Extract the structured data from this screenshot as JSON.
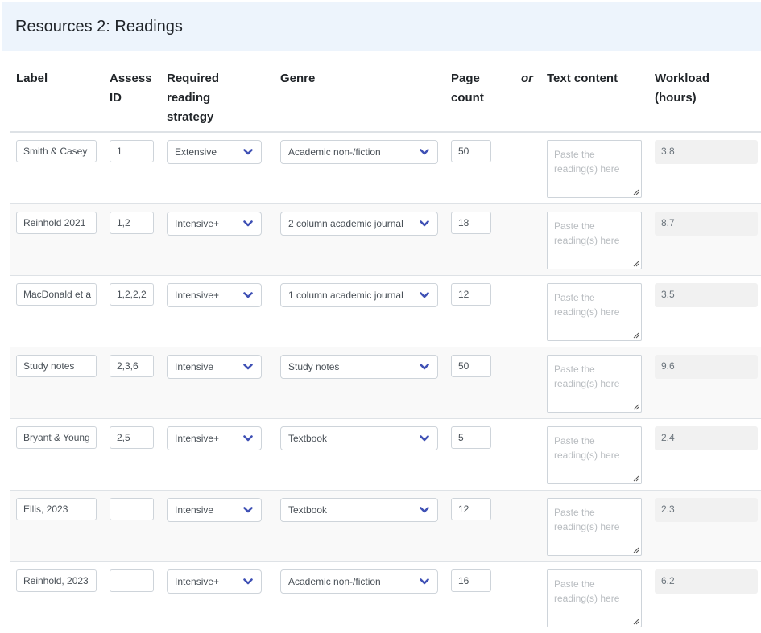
{
  "section": {
    "title": "Resources 2: Readings"
  },
  "columns": {
    "label": "Label",
    "assess_id": "Assess ID",
    "strategy": "Required reading strategy",
    "genre": "Genre",
    "page_count": "Page count",
    "or": "or",
    "text_content": "Text content",
    "workload": "Workload (hours)"
  },
  "textarea_placeholder": "Paste the reading(s) here",
  "colors": {
    "header_bg": "#edf4fc",
    "chevron": "#3f51b5",
    "row_alt_bg": "#f9f9f9"
  },
  "rows": [
    {
      "label": "Smith & Casey",
      "assess_id": "1",
      "strategy": "Extensive",
      "genre": "Academic non-/fiction",
      "page_count": "50",
      "workload": "3.8"
    },
    {
      "label": "Reinhold 2021",
      "assess_id": "1,2",
      "strategy": "Intensive+",
      "genre": "2 column academic journal",
      "page_count": "18",
      "workload": "8.7"
    },
    {
      "label": "MacDonald et a",
      "assess_id": "1,2,2,2",
      "strategy": "Intensive+",
      "genre": "1 column academic journal",
      "page_count": "12",
      "workload": "3.5"
    },
    {
      "label": "Study notes",
      "assess_id": "2,3,6",
      "strategy": "Intensive",
      "genre": "Study notes",
      "page_count": "50",
      "workload": "9.6"
    },
    {
      "label": "Bryant & Young",
      "assess_id": "2,5",
      "strategy": "Intensive+",
      "genre": "Textbook",
      "page_count": "5",
      "workload": "2.4"
    },
    {
      "label": "Ellis, 2023",
      "assess_id": "",
      "strategy": "Intensive",
      "genre": "Textbook",
      "page_count": "12",
      "workload": "2.3"
    },
    {
      "label": "Reinhold, 2023",
      "assess_id": "",
      "strategy": "Intensive+",
      "genre": "Academic non-/fiction",
      "page_count": "16",
      "workload": "6.2"
    }
  ]
}
